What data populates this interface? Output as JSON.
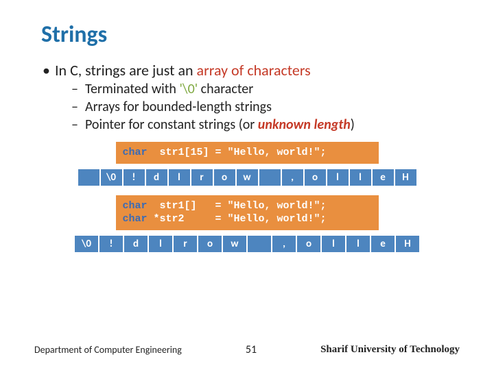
{
  "title": "Strings",
  "bullets": {
    "main": {
      "prefix": "In C, strings are just an ",
      "highlight": "array of characters"
    },
    "sub1": {
      "prefix": "Terminated with ",
      "highlight": "'\\0'",
      "suffix": " character"
    },
    "sub2": "Arrays for bounded-length strings",
    "sub3": {
      "prefix": "Pointer for constant strings (or ",
      "highlight": "unknown length",
      "suffix": ")"
    }
  },
  "code1": {
    "kw": "char",
    "rest": "  str1[15] = \"Hello, world!\";"
  },
  "array1": [
    "",
    "\\0",
    "!",
    "d",
    "l",
    "r",
    "o",
    "w",
    "",
    ",",
    "o",
    "l",
    "l",
    "e",
    "H"
  ],
  "code2": {
    "line1": {
      "kw": "char",
      "rest": "  str1[]   = \"Hello, world!\";"
    },
    "line2": {
      "kw": "char",
      "rest": " *str2     = \"Hello, world!\";"
    }
  },
  "array2": [
    "\\0",
    "!",
    "d",
    "l",
    "r",
    "o",
    "w",
    "",
    ",",
    "o",
    "l",
    "l",
    "e",
    "H"
  ],
  "footer": {
    "left": "Department of Computer Engineering",
    "center": "51",
    "right": "Sharif University of Technology"
  }
}
